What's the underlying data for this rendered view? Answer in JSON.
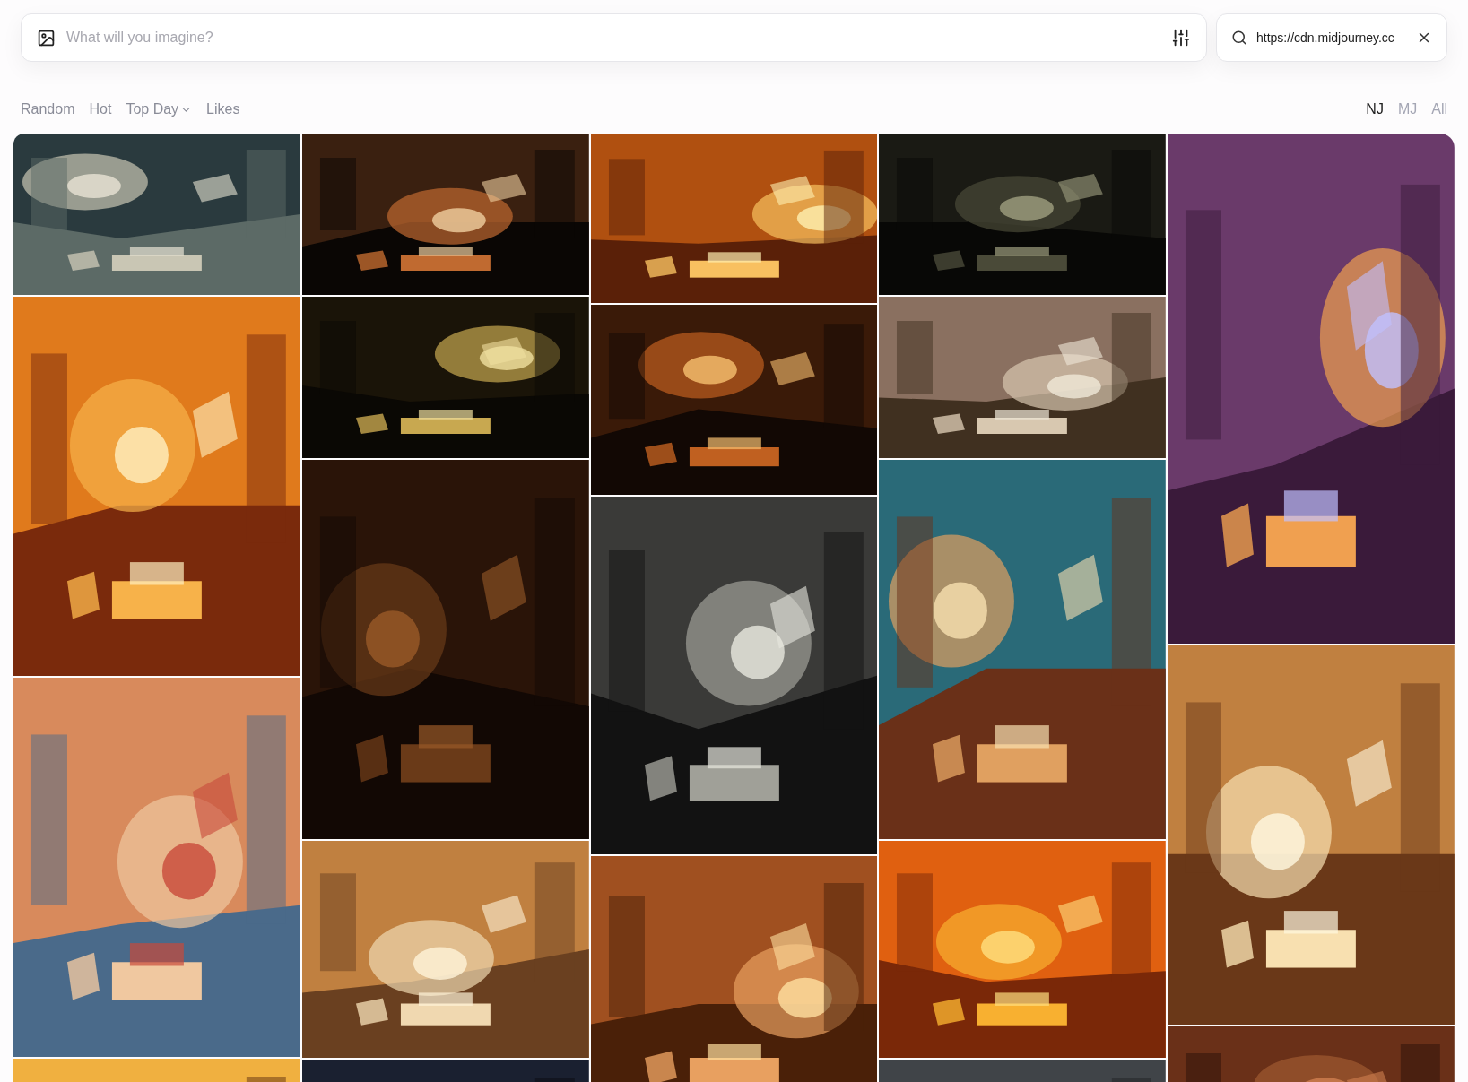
{
  "prompt_bar": {
    "placeholder": "What will you imagine?"
  },
  "search": {
    "value": "https://cdn.midjourney.cc"
  },
  "tabs": [
    {
      "label": "Random",
      "selected": false,
      "dropdown": false
    },
    {
      "label": "Hot",
      "selected": false,
      "dropdown": false
    },
    {
      "label": "Top Day",
      "selected": false,
      "dropdown": true
    },
    {
      "label": "Likes",
      "selected": false,
      "dropdown": false
    }
  ],
  "versions": [
    {
      "label": "NJ",
      "selected": true
    },
    {
      "label": "MJ",
      "selected": false
    },
    {
      "label": "All",
      "selected": false
    }
  ]
}
